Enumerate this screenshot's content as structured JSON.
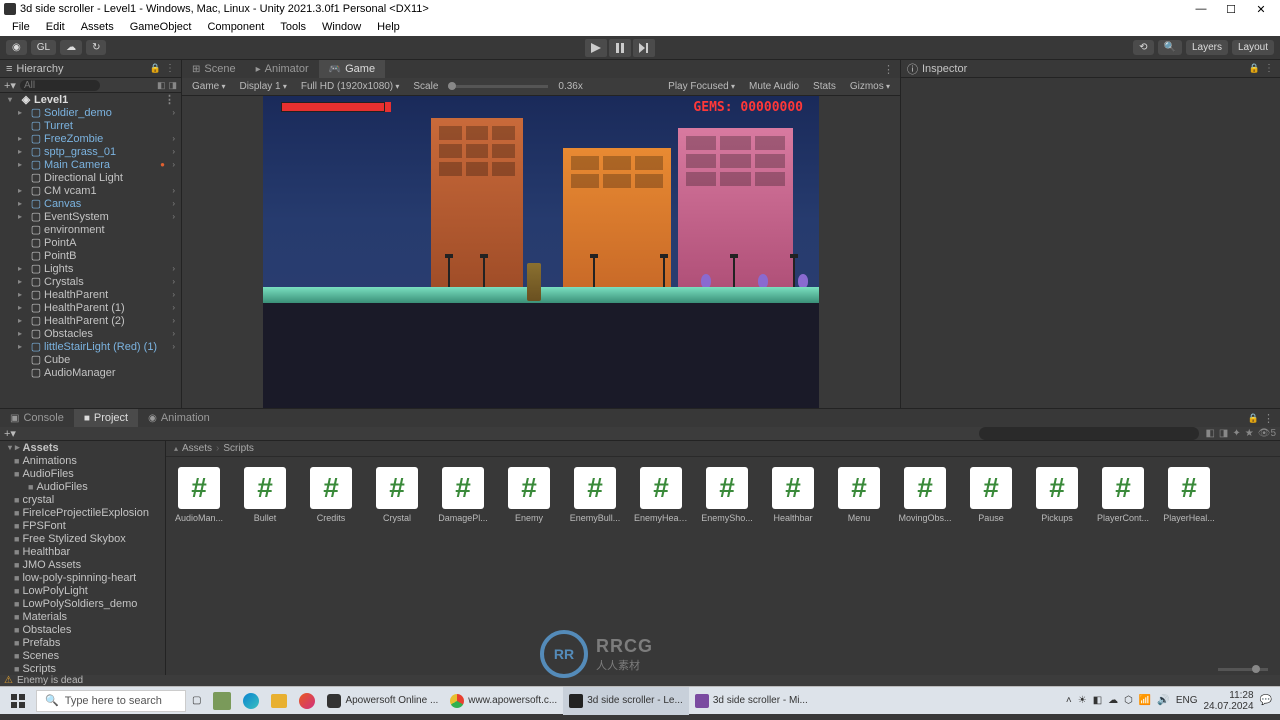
{
  "titlebar": {
    "title": "3d side scroller - Level1 - Windows, Mac, Linux - Unity 2021.3.0f1 Personal <DX11>"
  },
  "menubar": {
    "items": [
      "File",
      "Edit",
      "Assets",
      "GameObject",
      "Component",
      "Tools",
      "Window",
      "Help"
    ]
  },
  "toolbar": {
    "gl": "GL",
    "layers": "Layers",
    "layout": "Layout"
  },
  "hierarchy": {
    "title": "Hierarchy",
    "search_placeholder": "All",
    "root": "Level1",
    "items": [
      {
        "label": "Soldier_demo",
        "blue": true,
        "expand": true
      },
      {
        "label": "Turret",
        "blue": true
      },
      {
        "label": "FreeZombie",
        "blue": true,
        "expand": true
      },
      {
        "label": "sptp_grass_01",
        "blue": true,
        "expand": true
      },
      {
        "label": "Main Camera",
        "blue": true,
        "expand": true,
        "warn": true
      },
      {
        "label": "Directional Light"
      },
      {
        "label": "CM vcam1",
        "expand": true
      },
      {
        "label": "Canvas",
        "blue": true,
        "expand": true
      },
      {
        "label": "EventSystem",
        "expand": true
      },
      {
        "label": "environment"
      },
      {
        "label": "PointA"
      },
      {
        "label": "PointB"
      },
      {
        "label": "Lights",
        "expand": true
      },
      {
        "label": "Crystals",
        "expand": true
      },
      {
        "label": "HealthParent",
        "expand": true
      },
      {
        "label": "HealthParent (1)",
        "expand": true
      },
      {
        "label": "HealthParent (2)",
        "expand": true
      },
      {
        "label": "Obstacles",
        "expand": true
      },
      {
        "label": "littleStairLight (Red) (1)",
        "blue": true,
        "expand": true
      },
      {
        "label": "Cube"
      },
      {
        "label": "AudioManager"
      }
    ]
  },
  "center": {
    "tabs": [
      {
        "label": "Scene",
        "icon": "⊞"
      },
      {
        "label": "Animator",
        "icon": "▸"
      },
      {
        "label": "Game",
        "icon": "▸",
        "active": true
      }
    ],
    "game_toolbar": {
      "game": "Game",
      "display": "Display 1",
      "resolution": "Full HD (1920x1080)",
      "scale": "Scale",
      "scale_value": "0.36x",
      "play_focused": "Play Focused",
      "mute": "Mute Audio",
      "stats": "Stats",
      "gizmos": "Gizmos"
    },
    "hud": {
      "gems": "GEMS: 00000000"
    }
  },
  "inspector": {
    "title": "Inspector"
  },
  "bottom": {
    "tabs": [
      {
        "label": "Console",
        "icon": "▣"
      },
      {
        "label": "Project",
        "icon": "■",
        "active": true
      },
      {
        "label": "Animation",
        "icon": "◉"
      }
    ],
    "icon_count": "5",
    "folder_root": "Assets",
    "folders": [
      "Animations",
      "AudioFiles",
      "AudioFiles",
      "crystal",
      "FireIceProjectileExplosion",
      "FPSFont",
      "Free Stylized Skybox",
      "Healthbar",
      "JMO Assets",
      "low-poly-spinning-heart",
      "LowPolyLight",
      "LowPolySoldiers_demo",
      "Materials",
      "Obstacles",
      "Prefabs",
      "Scenes",
      "Scripts"
    ],
    "breadcrumb": [
      "Assets",
      "Scripts"
    ],
    "assets": [
      "AudioMan...",
      "Bullet",
      "Credits",
      "Crystal",
      "DamagePl...",
      "Enemy",
      "EnemyBull...",
      "EnemyHeal...",
      "EnemySho...",
      "Healthbar",
      "Menu",
      "MovingObs...",
      "Pause",
      "Pickups",
      "PlayerCont...",
      "PlayerHeal..."
    ]
  },
  "status": {
    "message": "Enemy is dead"
  },
  "taskbar": {
    "search_placeholder": "Type here to search",
    "items": [
      {
        "label": "Apowersoft Online ..."
      },
      {
        "label": "www.apowersoft.c..."
      },
      {
        "label": "3d side scroller - Le...",
        "active": true
      },
      {
        "label": "3d side scroller - Mi..."
      }
    ],
    "time": "11:28",
    "date": "24.07.2024"
  },
  "watermark": {
    "logo": "RR",
    "text": "RRCG",
    "sub": "人人素材"
  }
}
